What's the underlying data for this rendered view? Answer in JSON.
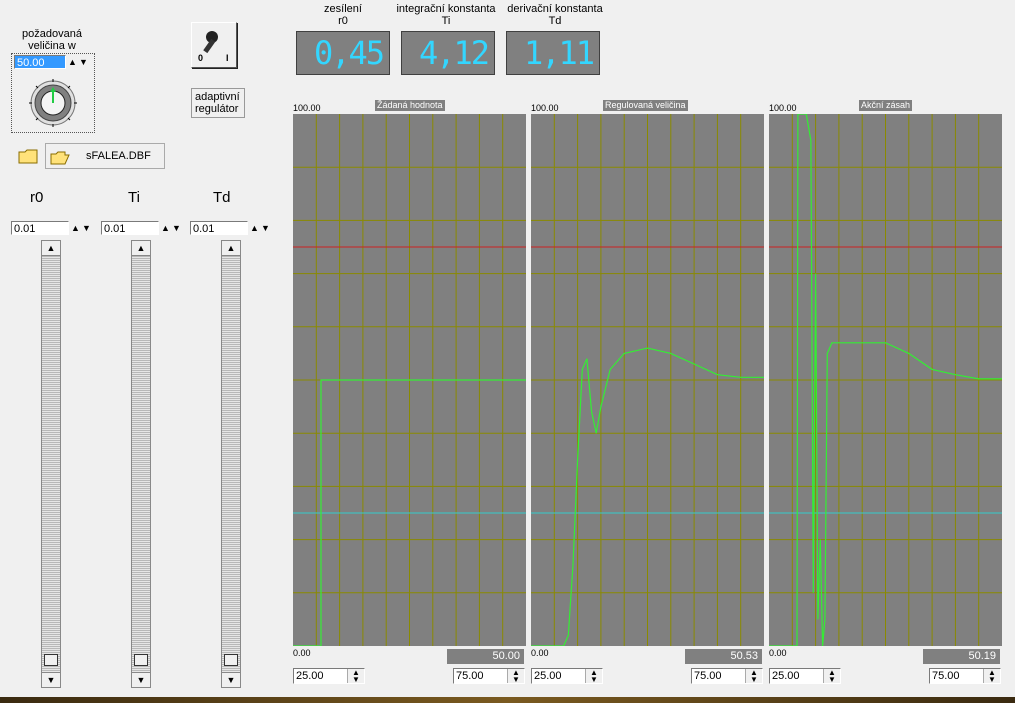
{
  "setpoint": {
    "label": "požadovaná veličina w",
    "value": "50.00"
  },
  "switch": {
    "label_off": "0",
    "label_on": "I"
  },
  "adaptive_button": {
    "label": "adaptivní regulátor"
  },
  "file": {
    "name": "sFALEA.DBF"
  },
  "tuning": {
    "r0": {
      "label": "r0",
      "value": "0.01"
    },
    "ti": {
      "label": "Ti",
      "value": "0.01"
    },
    "td": {
      "label": "Td",
      "value": "0.01"
    }
  },
  "displays": [
    {
      "line1": "zesílení",
      "line2": "r0",
      "value": "0.45"
    },
    {
      "line1": "integrační konstanta",
      "line2": "Ti",
      "value": "4.12"
    },
    {
      "line1": "derivační konstanta",
      "line2": "Td",
      "value": "1.11"
    }
  ],
  "charts": [
    {
      "title": "Žádaná hodnota",
      "ymax": "100.00",
      "ymin": "0.00",
      "current": "50.00",
      "xmin": "25.00",
      "xmax": "75.00"
    },
    {
      "title": "Regulovaná veličina",
      "ymax": "100.00",
      "ymin": "0.00",
      "current": "50.53",
      "xmin": "25.00",
      "xmax": "75.00"
    },
    {
      "title": "Akční zásah",
      "ymax": "100.00",
      "ymin": "0.00",
      "current": "50.19",
      "xmin": "25.00",
      "xmax": "75.00"
    }
  ],
  "chart_data": [
    {
      "type": "line",
      "title": "Žádaná hodnota",
      "ylim": [
        0,
        100
      ],
      "xlim": [
        25,
        75
      ],
      "series": [
        {
          "x": [
            25,
            31,
            31,
            75
          ],
          "values": [
            0,
            0,
            50,
            50
          ]
        }
      ]
    },
    {
      "type": "line",
      "title": "Regulovaná veličina",
      "ylim": [
        0,
        100
      ],
      "xlim": [
        25,
        75
      ],
      "series": [
        {
          "x": [
            25,
            32,
            33,
            34,
            35,
            36,
            37,
            38,
            39,
            40,
            42,
            45,
            50,
            55,
            60,
            65,
            70,
            75
          ],
          "values": [
            0,
            0,
            2,
            15,
            35,
            52,
            54,
            44,
            40,
            45,
            52,
            55,
            56,
            55,
            53,
            51,
            50.5,
            50.5
          ]
        }
      ]
    },
    {
      "type": "line",
      "title": "Akční zásah",
      "ylim": [
        0,
        100
      ],
      "xlim": [
        25,
        75
      ],
      "series": [
        {
          "x": [
            25,
            31,
            31.2,
            33,
            34,
            34.5,
            35,
            35.5,
            36,
            36.5,
            37,
            37.5,
            38,
            38.5,
            40,
            45,
            50,
            55,
            60,
            65,
            70,
            75
          ],
          "values": [
            0,
            0,
            100,
            100,
            95,
            10,
            70,
            5,
            20,
            0,
            5,
            55,
            56,
            57,
            57,
            57,
            57,
            55,
            52,
            51,
            50.2,
            50.2
          ]
        }
      ],
      "reference_lines": [
        75,
        25
      ]
    }
  ]
}
